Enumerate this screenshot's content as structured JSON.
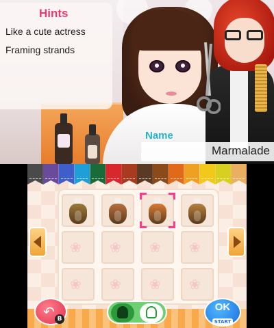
{
  "hints": {
    "title": "Hints",
    "lines": [
      "Like a cute actress",
      "Framing strands"
    ]
  },
  "client": {
    "name_label": "Name",
    "name_value": "Marmalade"
  },
  "palette": {
    "tabs": [
      "#4a4a4a",
      "#6a4a9a",
      "#3e5fc8",
      "#1f9fd8",
      "#1a6b3a",
      "#d8282e",
      "#a83a22",
      "#5a3a22",
      "#8a4a1a",
      "#e06a1a",
      "#f0a020",
      "#f2c81a",
      "#d8d020",
      "#e8b060"
    ],
    "swatches": [
      {
        "name": "olive-brown",
        "color": "#9a7a3a"
      },
      {
        "name": "copper-brown",
        "color": "#b86e3e"
      },
      {
        "name": "orange-copper",
        "color": "#d87a34"
      },
      {
        "name": "light-brown",
        "color": "#b68040"
      }
    ],
    "selected_index": 2
  },
  "controls": {
    "back_key": "B",
    "ok_label": "OK",
    "start_label": "START"
  },
  "icons": {
    "back": "undo-arrow-icon",
    "left": "arrow-left-icon",
    "right": "arrow-right-icon",
    "style_a": "hair-style-icon",
    "style_b": "hair-outline-icon"
  },
  "colors": {
    "hint_title": "#e83a6e",
    "name_label": "#1fb4c8",
    "selection": "#ff3a8c"
  }
}
